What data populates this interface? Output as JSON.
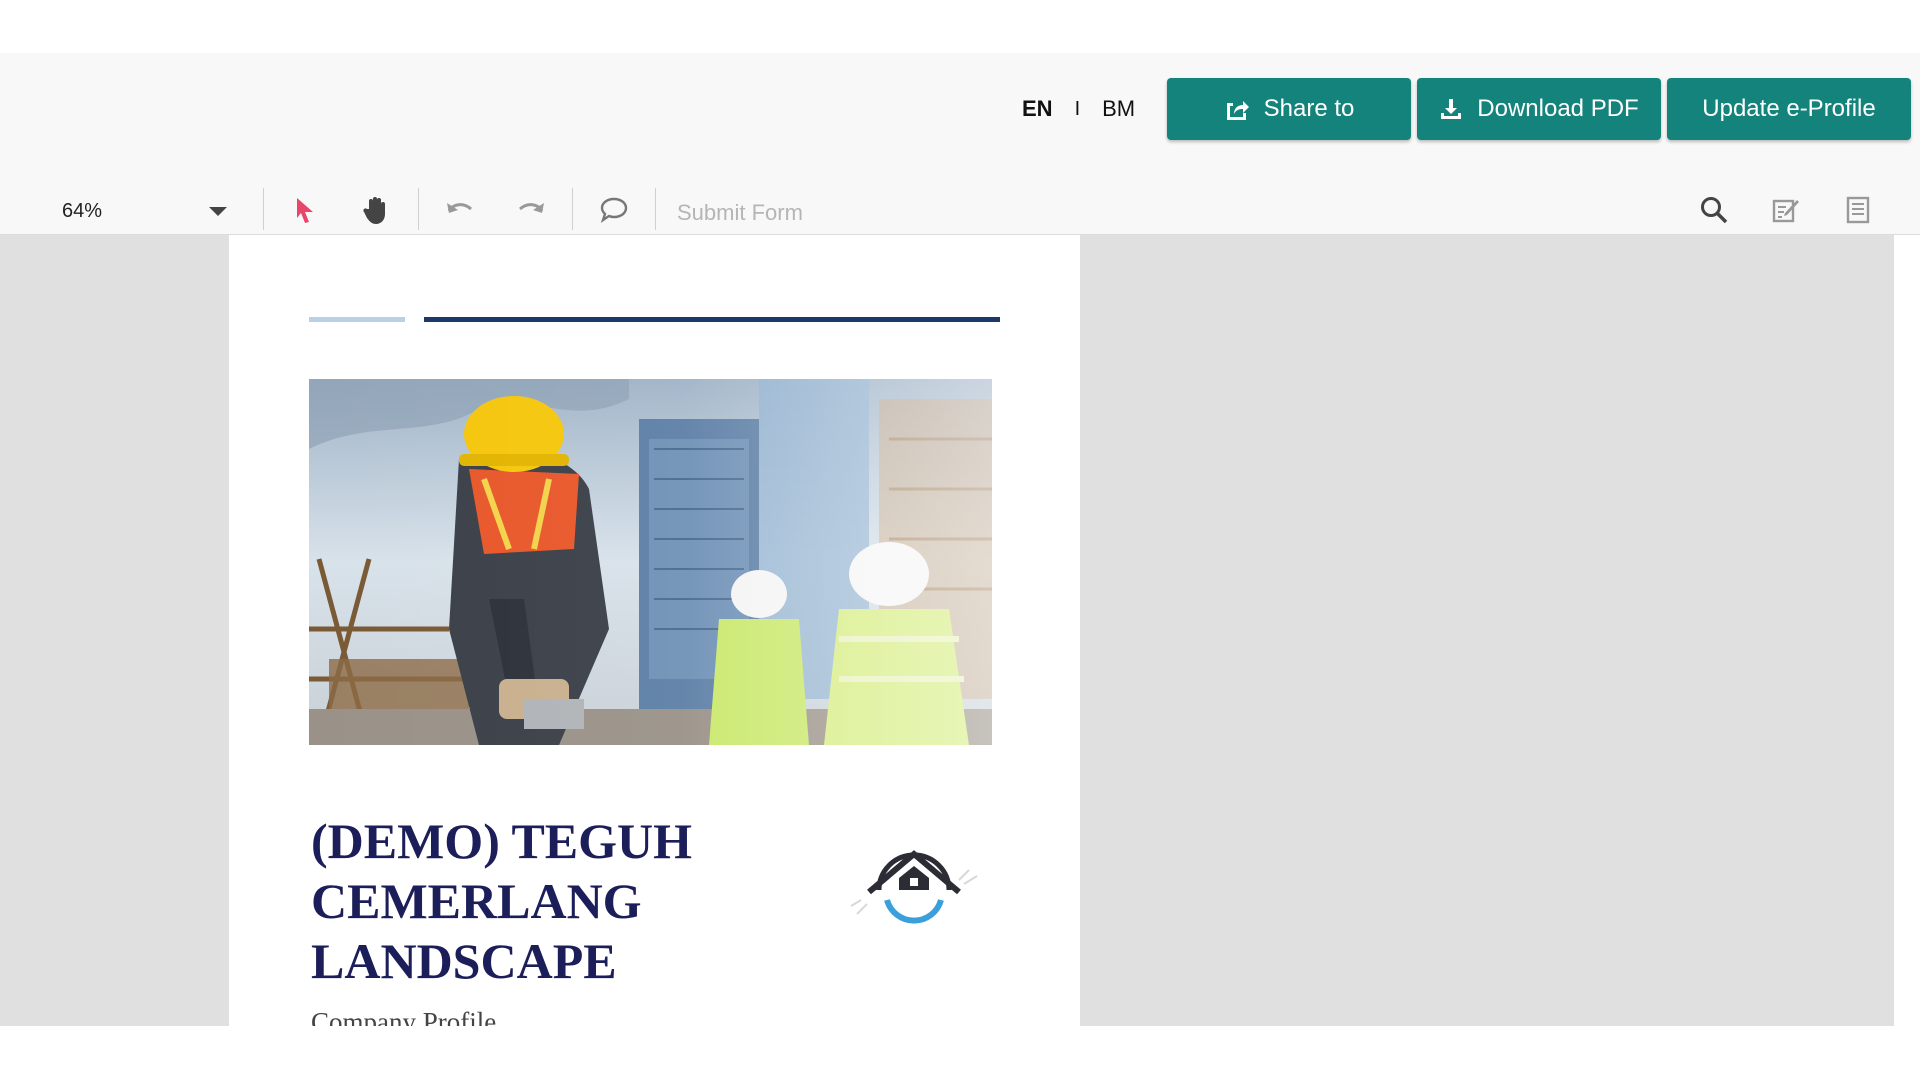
{
  "header": {
    "languages": {
      "en": "EN",
      "separator": "I",
      "bm": "BM"
    },
    "share_label": "Share to",
    "download_label": "Download PDF",
    "update_label": "Update e-Profile",
    "button_color": "#14837b"
  },
  "toolbar": {
    "zoom": "64%",
    "submit_label": "Submit Form",
    "tools": [
      "select-pointer-icon",
      "hand-pan-icon",
      "undo-icon",
      "redo-icon",
      "comment-icon",
      "search-icon",
      "edit-form-icon",
      "page-view-icon"
    ],
    "select_accent": "#e8476a"
  },
  "document": {
    "title": "(DEMO) TEGUH CEMERLANG LANDSCAPE",
    "subtitle": "Company Profile",
    "title_color": "#1c1e5a",
    "accent_bar_light": "#b8d0e8",
    "accent_bar_dark": "#1b3a6b"
  }
}
